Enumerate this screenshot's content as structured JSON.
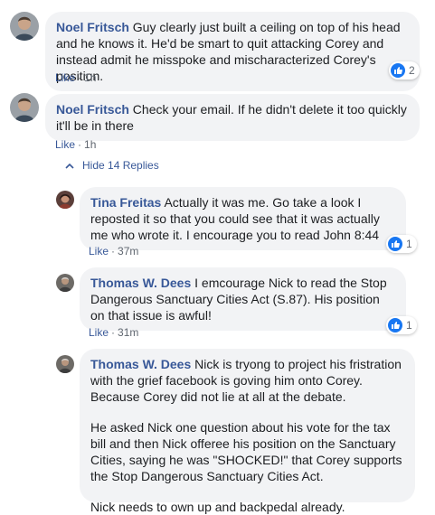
{
  "comments": [
    {
      "author": "Noel Fritsch",
      "text": "Guy clearly just built a ceiling on top of his head and he knows it. He'd be smart to quit attacking Corey and instead admit he misspoke and mischaracterized Corey's position.",
      "like_label": "Like",
      "time": "1h",
      "reaction_count": "2"
    },
    {
      "author": "Noel Fritsch",
      "text": "Check your email. If he didn't delete it too quickly it'll be in there",
      "like_label": "Like",
      "time": "1h"
    }
  ],
  "hide_replies_label": "Hide 14 Replies",
  "replies": [
    {
      "author": "Tina Freitas",
      "text": "Actually it was me. Go take a look I reposted it so that you could see that it was actually me who wrote it. I encourage you to read John 8:44",
      "like_label": "Like",
      "time": "37m",
      "reaction_count": "1"
    },
    {
      "author": "Thomas W. Dees",
      "text": "I emcourage Nick to read the Stop Dangerous Sanctuary Cities Act (S.87). His position on that issue is awful!",
      "like_label": "Like",
      "time": "31m",
      "reaction_count": "1"
    },
    {
      "author": "Thomas W. Dees",
      "text": "Nick is tryong to project his fristration with the grief facebook is goving him onto Corey. Because Corey did not lie at all at the debate.",
      "paragraph2": "He asked Nick one question about his vote for the tax bill and then Nick offeree his position on the Sanctuary Cities, saying he was \"SHOCKED!\" that Corey supports the Stop Dangerous Sanctuary Cities Act.",
      "paragraph3": "Nick needs to own up and backpedal already."
    }
  ],
  "colors": {
    "link": "#385898",
    "bubble": "#f2f3f5",
    "reaction": "#1877f2",
    "meta": "#606770"
  },
  "icons": {
    "reaction": "thumbs-up-icon",
    "collapse": "chevron-up-icon"
  }
}
